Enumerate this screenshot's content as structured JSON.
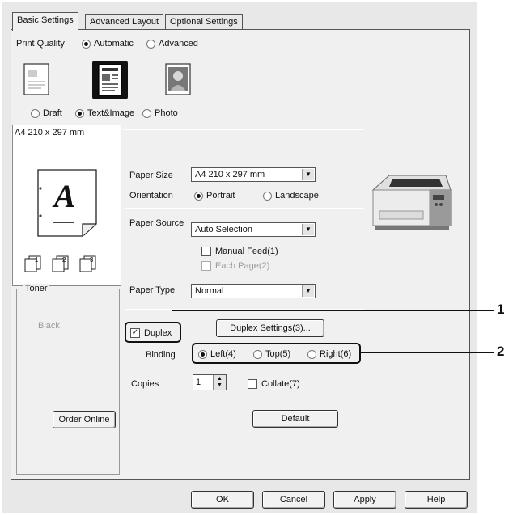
{
  "tabs": [
    {
      "label": "Basic Settings"
    },
    {
      "label": "Advanced Layout"
    },
    {
      "label": "Optional Settings"
    }
  ],
  "print_quality": {
    "label": "Print Quality",
    "automatic": "Automatic",
    "advanced": "Advanced",
    "selected": "Automatic",
    "modes": [
      "Draft",
      "Text&Image",
      "Photo"
    ],
    "selected_mode": "Text&Image"
  },
  "preview": {
    "size_label": "A4 210 x 297 mm",
    "letter": "A",
    "page_numbers": [
      "1",
      "2",
      "3"
    ]
  },
  "paper_size": {
    "label": "Paper Size",
    "value": "A4 210 x 297 mm"
  },
  "orientation": {
    "label": "Orientation",
    "portrait": "Portrait",
    "landscape": "Landscape",
    "selected": "Portrait"
  },
  "paper_source": {
    "label": "Paper Source",
    "value": "Auto Selection"
  },
  "manual_feed": {
    "label": "Manual Feed(1)",
    "checked": false
  },
  "each_page": {
    "label": "Each Page(2)",
    "checked": false,
    "disabled": true
  },
  "paper_type": {
    "label": "Paper Type",
    "value": "Normal"
  },
  "toner": {
    "legend": "Toner",
    "color_label": "Black",
    "order_button": "Order Online"
  },
  "duplex": {
    "label": "Duplex",
    "checked": true,
    "settings_button": "Duplex Settings(3)..."
  },
  "binding": {
    "label": "Binding",
    "left": "Left(4)",
    "top": "Top(5)",
    "right": "Right(6)",
    "selected": "Left(4)"
  },
  "copies": {
    "label": "Copies",
    "value": "1"
  },
  "collate": {
    "label": "Collate(7)",
    "checked": false
  },
  "default_button": "Default",
  "footer": {
    "ok": "OK",
    "cancel": "Cancel",
    "apply": "Apply",
    "help": "Help"
  },
  "callouts": {
    "one": "1",
    "two": "2"
  },
  "colors": {
    "window_bg": "#f0f0f0",
    "border": "#555555"
  }
}
